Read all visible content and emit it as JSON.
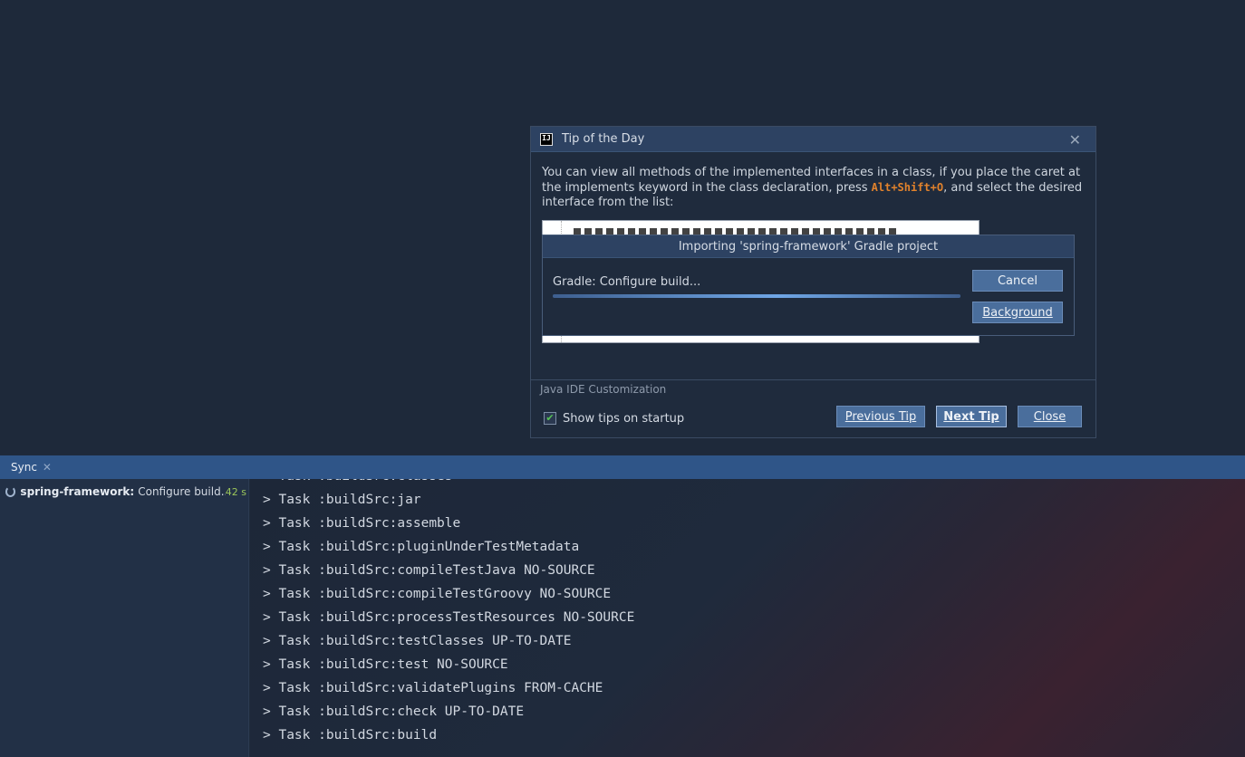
{
  "tip_dialog": {
    "title": "Tip of the Day",
    "text_before": "You can view all methods of the implemented interfaces in a class, if you place the caret at the implements keyword in the class declaration, press ",
    "shortcut": "Alt+Shift+O",
    "text_after": ", and select the desired interface from the list:",
    "category": "Java IDE Customization",
    "show_tips_label": "Show tips on startup",
    "show_tips_checked": true,
    "previous_label": "Previous Tip",
    "next_label": "Next Tip",
    "close_label": "Close"
  },
  "import_dialog": {
    "title": "Importing 'spring-framework' Gradle project",
    "status": "Gradle: Configure build...",
    "progress": 1.0,
    "cancel_label": "Cancel",
    "background_label": "Background"
  },
  "tool_window": {
    "tab_label": "Sync",
    "tree": {
      "project": "spring-framework:",
      "description": "Configure build...",
      "elapsed": "42 s"
    },
    "console_lines": [
      "> Task :buildSrc:classes",
      "> Task :buildSrc:jar",
      "> Task :buildSrc:assemble",
      "> Task :buildSrc:pluginUnderTestMetadata",
      "> Task :buildSrc:compileTestJava NO-SOURCE",
      "> Task :buildSrc:compileTestGroovy NO-SOURCE",
      "> Task :buildSrc:processTestResources NO-SOURCE",
      "> Task :buildSrc:testClasses UP-TO-DATE",
      "> Task :buildSrc:test NO-SOURCE",
      "> Task :buildSrc:validatePlugins FROM-CACHE",
      "> Task :buildSrc:check UP-TO-DATE",
      "> Task :buildSrc:build"
    ]
  },
  "colors": {
    "accent": "#2f5588",
    "shortcut": "#e1822c",
    "elapsed": "#9bc65a"
  }
}
